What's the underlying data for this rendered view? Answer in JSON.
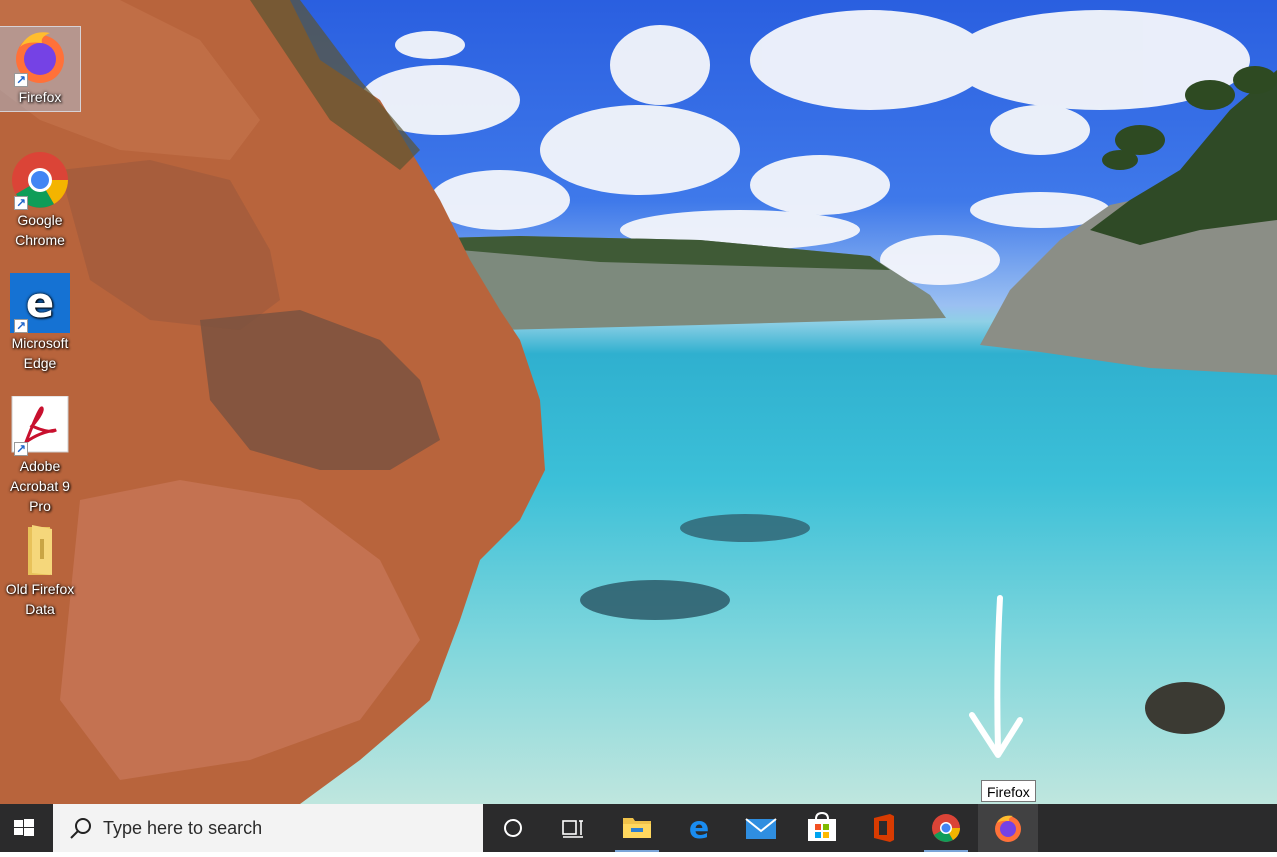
{
  "desktop": {
    "icons": [
      {
        "label": "Firefox",
        "icon": "firefox-icon"
      },
      {
        "label": "Google Chrome",
        "icon": "chrome-icon"
      },
      {
        "label": "Microsoft Edge",
        "icon": "edge-icon"
      },
      {
        "label": "Adobe Acrobat 9 Pro",
        "icon": "acrobat-icon"
      },
      {
        "label": "Old Firefox Data",
        "icon": "folder-icon"
      }
    ]
  },
  "taskbar": {
    "search_placeholder": "Type here to search",
    "apps": [
      "cortana-icon",
      "task-view-icon",
      "file-explorer-icon",
      "edge-icon",
      "mail-icon",
      "store-icon",
      "office-icon",
      "chrome-icon",
      "firefox-icon"
    ],
    "tooltip": "Firefox"
  },
  "colors": {
    "taskbar": "#2b2b2c",
    "search_box": "#f3f3f3",
    "indicator": "#7aa5d8"
  }
}
